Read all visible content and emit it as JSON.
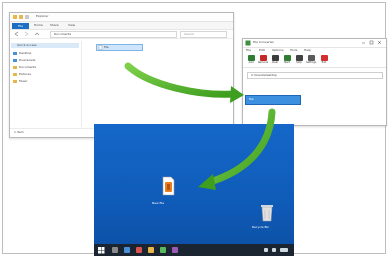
{
  "explorer": {
    "title": "Explorer",
    "tabs": [
      "File",
      "Home",
      "Share",
      "View"
    ],
    "file_tab": "File",
    "address": "Documents",
    "search_placeholder": "Search",
    "nav_items": [
      "Quick access",
      "Desktop",
      "Downloads",
      "Documents",
      "Pictures",
      "Music"
    ],
    "selected_file": "file",
    "status": "1 item"
  },
  "program": {
    "title": "File Converter",
    "menu": [
      "File",
      "Edit",
      "Options",
      "Tools",
      "Help"
    ],
    "toolbar": [
      "Add",
      "Remove",
      "Clear",
      "Start",
      "Stop",
      "Settings",
      "Exit"
    ],
    "path": "C:\\Users\\Desktop",
    "drop_file": "file"
  },
  "desktop": {
    "icon1_label": "New file",
    "icon2_label": "Recycle Bin"
  },
  "colors": {
    "desktop": "#1567c9",
    "arrow": "#4caf24",
    "selection": "#3d8fe0"
  }
}
